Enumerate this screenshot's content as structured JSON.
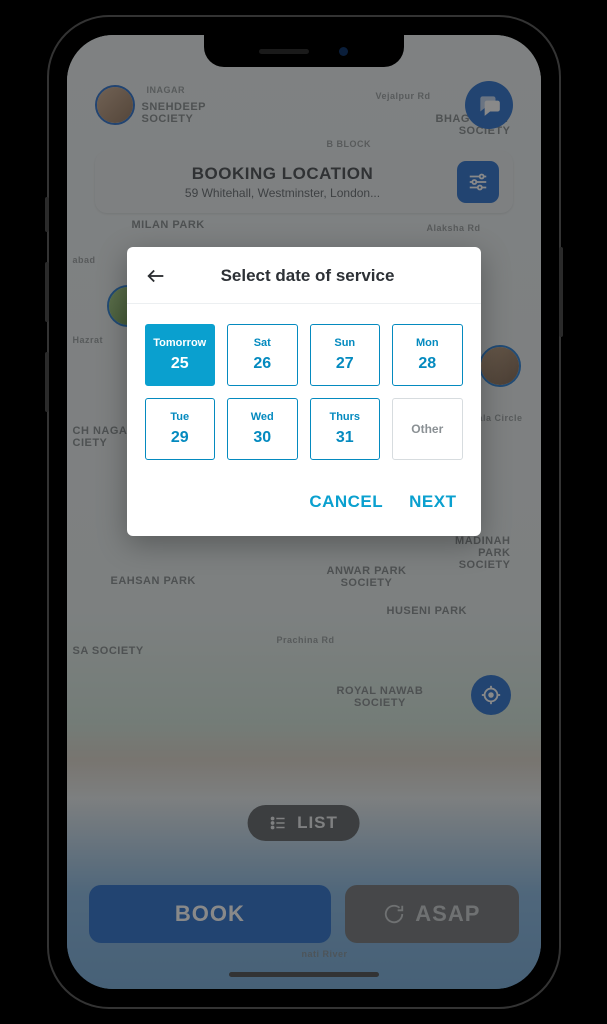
{
  "booking": {
    "title": "BOOKING LOCATION",
    "address": "59 Whitehall, Westminster, London..."
  },
  "listButton": "LIST",
  "bottom": {
    "book": "BOOK",
    "asap": "ASAP"
  },
  "modal": {
    "title": "Select date of service",
    "cancel": "CANCEL",
    "next": "NEXT",
    "dates": [
      {
        "label": "Tomorrow",
        "num": "25",
        "selected": true
      },
      {
        "label": "Sat",
        "num": "26"
      },
      {
        "label": "Sun",
        "num": "27"
      },
      {
        "label": "Mon",
        "num": "28"
      },
      {
        "label": "Tue",
        "num": "29"
      },
      {
        "label": "Wed",
        "num": "30"
      },
      {
        "label": "Thurs",
        "num": "31"
      },
      {
        "label": "Other",
        "other": true
      }
    ]
  },
  "mapLabels": {
    "inagar": "INAGAR",
    "snehdeep": "SNEHDEEP\nSOCIETY",
    "bblock": "B BLOCK",
    "bhagyoday": "BHAGYODAY\nSOCIETY",
    "milan": "MILAN PARK",
    "vejalpur": "Vejalpur Rd",
    "alaksha": "Alaksha Rd",
    "hazrat": "Hazrat",
    "chnagar": "CH NAGAR\nCIETY",
    "alacircle": "ala Circle",
    "ehsan": "EAHSAN PARK",
    "anwar": "ANWAR PARK\nSOCIETY",
    "madina": "MADINAH\nPARK\nSOCIETY",
    "huseni": "HUSENI PARK",
    "sasociety": "SA SOCIETY",
    "prachina": "Prachina Rd",
    "royal": "ROYAL NAWAB\nSOCIETY",
    "river": "nati River",
    "abad": "abad"
  }
}
